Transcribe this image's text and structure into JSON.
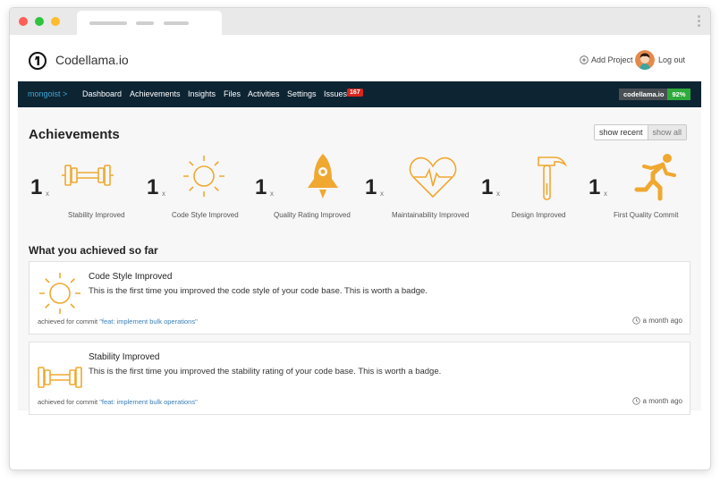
{
  "header": {
    "brand": "Codellama.io",
    "add_project": "Add Project",
    "logout": "Log out"
  },
  "nav": {
    "project": "mongoist >",
    "items": [
      "Dashboard",
      "Achievements",
      "Insights",
      "Files",
      "Activities",
      "Settings",
      "Issues"
    ],
    "issues_count": "167",
    "score_label": "codellama.io",
    "score_value": "92%"
  },
  "page": {
    "title": "Achievements",
    "show_recent": "show recent",
    "show_all": "show all",
    "subtitle": "What you achieved so far"
  },
  "badges": [
    {
      "count": "1",
      "x": "x",
      "label": "Stability Improved",
      "icon": "dumbbell-icon"
    },
    {
      "count": "1",
      "x": "x",
      "label": "Code Style Improved",
      "icon": "sun-icon"
    },
    {
      "count": "1",
      "x": "x",
      "label": "Quality Rating Improved",
      "icon": "rocket-icon"
    },
    {
      "count": "1",
      "x": "x",
      "label": "Maintainability Improved",
      "icon": "heart-pulse-icon"
    },
    {
      "count": "1",
      "x": "x",
      "label": "Design Improved",
      "icon": "hammer-icon"
    },
    {
      "count": "1",
      "x": "x",
      "label": "First Quality Commit",
      "icon": "runner-icon"
    }
  ],
  "cards": [
    {
      "title": "Code Style Improved",
      "desc": "This is the first time you improved the code style of your code base. This is worth a badge.",
      "commit_prefix": "achieved for commit ",
      "commit_msg": "\"feat: implement bulk operations\"",
      "time": "a month ago",
      "icon": "sun-icon"
    },
    {
      "title": "Stability Improved",
      "desc": "This is the first time you improved the stability rating of your code base. This is worth a badge.",
      "commit_prefix": "achieved for commit ",
      "commit_msg": "\"feat: implement bulk operations\"",
      "time": "a month ago",
      "icon": "dumbbell-icon"
    }
  ],
  "colors": {
    "accent": "#f0a830",
    "navbar": "#0d2433",
    "score_green": "#2eaa3b",
    "issues_red": "#d9261c"
  }
}
